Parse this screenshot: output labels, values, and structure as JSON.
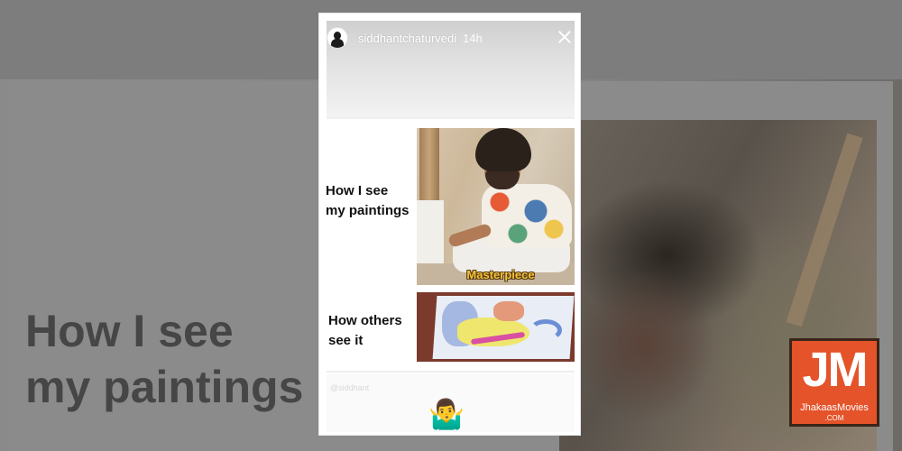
{
  "story": {
    "username": "siddhantchaturvedi",
    "time_ago": "14h",
    "meme": {
      "label_top": "How I see\nmy paintings",
      "label_bottom": "How others\nsee it",
      "photo_caption": "Masterpiece"
    },
    "handle_watermark": "@siddhant",
    "emoji": "🤷‍♂️"
  },
  "background": {
    "caption": "How I see\nmy paintings"
  },
  "logo": {
    "letters": "JM",
    "name": "JhakaasMovies",
    "sub": ".COM"
  },
  "colors": {
    "logo_bg": "#e4532a",
    "caption_gold": "#f0c43b"
  }
}
